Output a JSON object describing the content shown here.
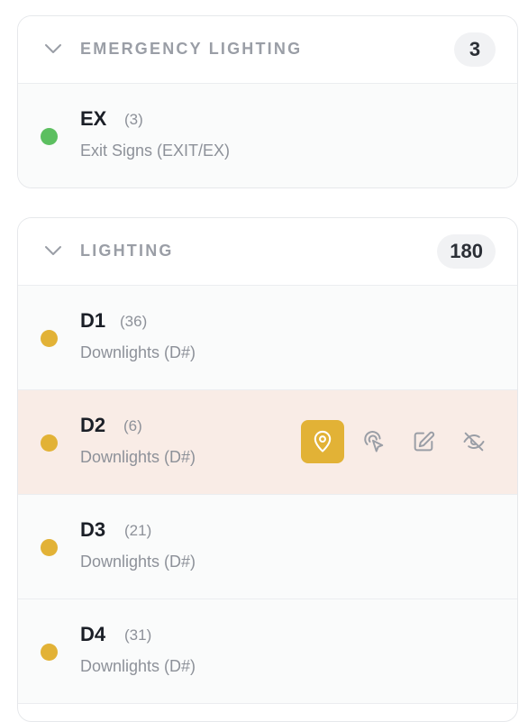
{
  "groups": [
    {
      "title": "EMERGENCY LIGHTING",
      "count": "3",
      "items": [
        {
          "code": "EX",
          "qty": "(3)",
          "description": "Exit Signs (EXIT/EX)",
          "dot_color": "#5cbf60"
        }
      ]
    },
    {
      "title": "LIGHTING",
      "count": "180",
      "items": [
        {
          "code": "D1",
          "qty": "(36)",
          "description": "Downlights (D#)",
          "dot_color": "#e2b236"
        },
        {
          "code": "D2",
          "qty": "(6)",
          "description": "Downlights (D#)",
          "dot_color": "#e2b236",
          "active": true
        },
        {
          "code": "D3",
          "qty": "(21)",
          "description": "Downlights (D#)",
          "dot_color": "#e2b236"
        },
        {
          "code": "D4",
          "qty": "(31)",
          "description": "Downlights (D#)",
          "dot_color": "#e2b236"
        }
      ]
    }
  ],
  "row_actions": [
    {
      "icon": "map-pin-icon",
      "active": true
    },
    {
      "icon": "pointer-select-icon"
    },
    {
      "icon": "edit-icon"
    },
    {
      "icon": "eye-off-icon"
    }
  ],
  "colors": {
    "accent": "#e2b236",
    "active_row_bg": "#f9ece6",
    "emergency_dot": "#5cbf60",
    "lighting_dot": "#e2b236"
  }
}
